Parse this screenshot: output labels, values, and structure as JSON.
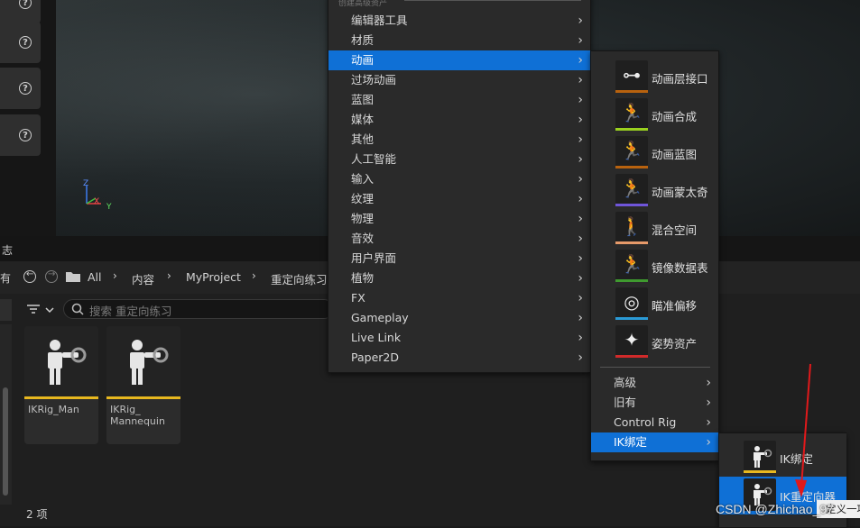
{
  "viewport": {
    "axis_labels": {
      "z": "Z",
      "x": "X",
      "y": "Y"
    },
    "help_icons": [
      "question-icon",
      "question-icon",
      "question-icon",
      "question-icon"
    ]
  },
  "content_browser": {
    "title_fragment": "志",
    "left_fragment": "有",
    "breadcrumbs": [
      "All",
      "内容",
      "MyProject",
      "重定向练习"
    ],
    "search_placeholder": "搜索 重定向练习",
    "assets": [
      {
        "name": "IKRig_Man"
      },
      {
        "name": "IKRig_\nMannequin"
      }
    ],
    "item_count": "2 项"
  },
  "main_menu": {
    "header": "创建高级资产",
    "items": [
      {
        "label": "编辑器工具",
        "selected": false
      },
      {
        "label": "材质",
        "selected": false
      },
      {
        "label": "动画",
        "selected": true
      },
      {
        "label": "过场动画",
        "selected": false
      },
      {
        "label": "蓝图",
        "selected": false
      },
      {
        "label": "媒体",
        "selected": false
      },
      {
        "label": "其他",
        "selected": false
      },
      {
        "label": "人工智能",
        "selected": false
      },
      {
        "label": "输入",
        "selected": false
      },
      {
        "label": "纹理",
        "selected": false
      },
      {
        "label": "物理",
        "selected": false
      },
      {
        "label": "音效",
        "selected": false
      },
      {
        "label": "用户界面",
        "selected": false
      },
      {
        "label": "植物",
        "selected": false
      },
      {
        "label": "FX",
        "selected": false
      },
      {
        "label": "Gameplay",
        "selected": false
      },
      {
        "label": "Live Link",
        "selected": false
      },
      {
        "label": "Paper2D",
        "selected": false
      }
    ]
  },
  "animation_submenu": {
    "assets": [
      {
        "label": "动画层接口",
        "icon": "anim-layer-interface-icon",
        "stripe": "#b8620e"
      },
      {
        "label": "动画合成",
        "icon": "anim-composite-icon",
        "stripe": "#9ad11f"
      },
      {
        "label": "动画蓝图",
        "icon": "anim-blueprint-icon",
        "stripe": "#b8620e"
      },
      {
        "label": "动画蒙太奇",
        "icon": "anim-montage-icon",
        "stripe": "#6f55d9"
      },
      {
        "label": "混合空间",
        "icon": "blend-space-icon",
        "stripe": "#e69a6a"
      },
      {
        "label": "镜像数据表",
        "icon": "mirror-data-table-icon",
        "stripe": "#3f9a2f"
      },
      {
        "label": "瞄准偏移",
        "icon": "aim-offset-icon",
        "stripe": "#2a9ad6"
      },
      {
        "label": "姿势资产",
        "icon": "pose-asset-icon",
        "stripe": "#d12a2a"
      }
    ],
    "categories": [
      {
        "label": "高级",
        "selected": false
      },
      {
        "label": "旧有",
        "selected": false
      },
      {
        "label": "Control Rig",
        "selected": false
      },
      {
        "label": "IK绑定",
        "selected": true
      }
    ]
  },
  "ik_submenu": {
    "items": [
      {
        "label": "IK绑定",
        "selected": false
      },
      {
        "label": "IK重定向器",
        "selected": true
      }
    ]
  },
  "tooltip": "定义一项",
  "watermark": "CSDN @Zhichao_97",
  "colors": {
    "accent": "#0f70d6",
    "asset_bar": "#e8b81f",
    "arrow": "#e0191b"
  }
}
